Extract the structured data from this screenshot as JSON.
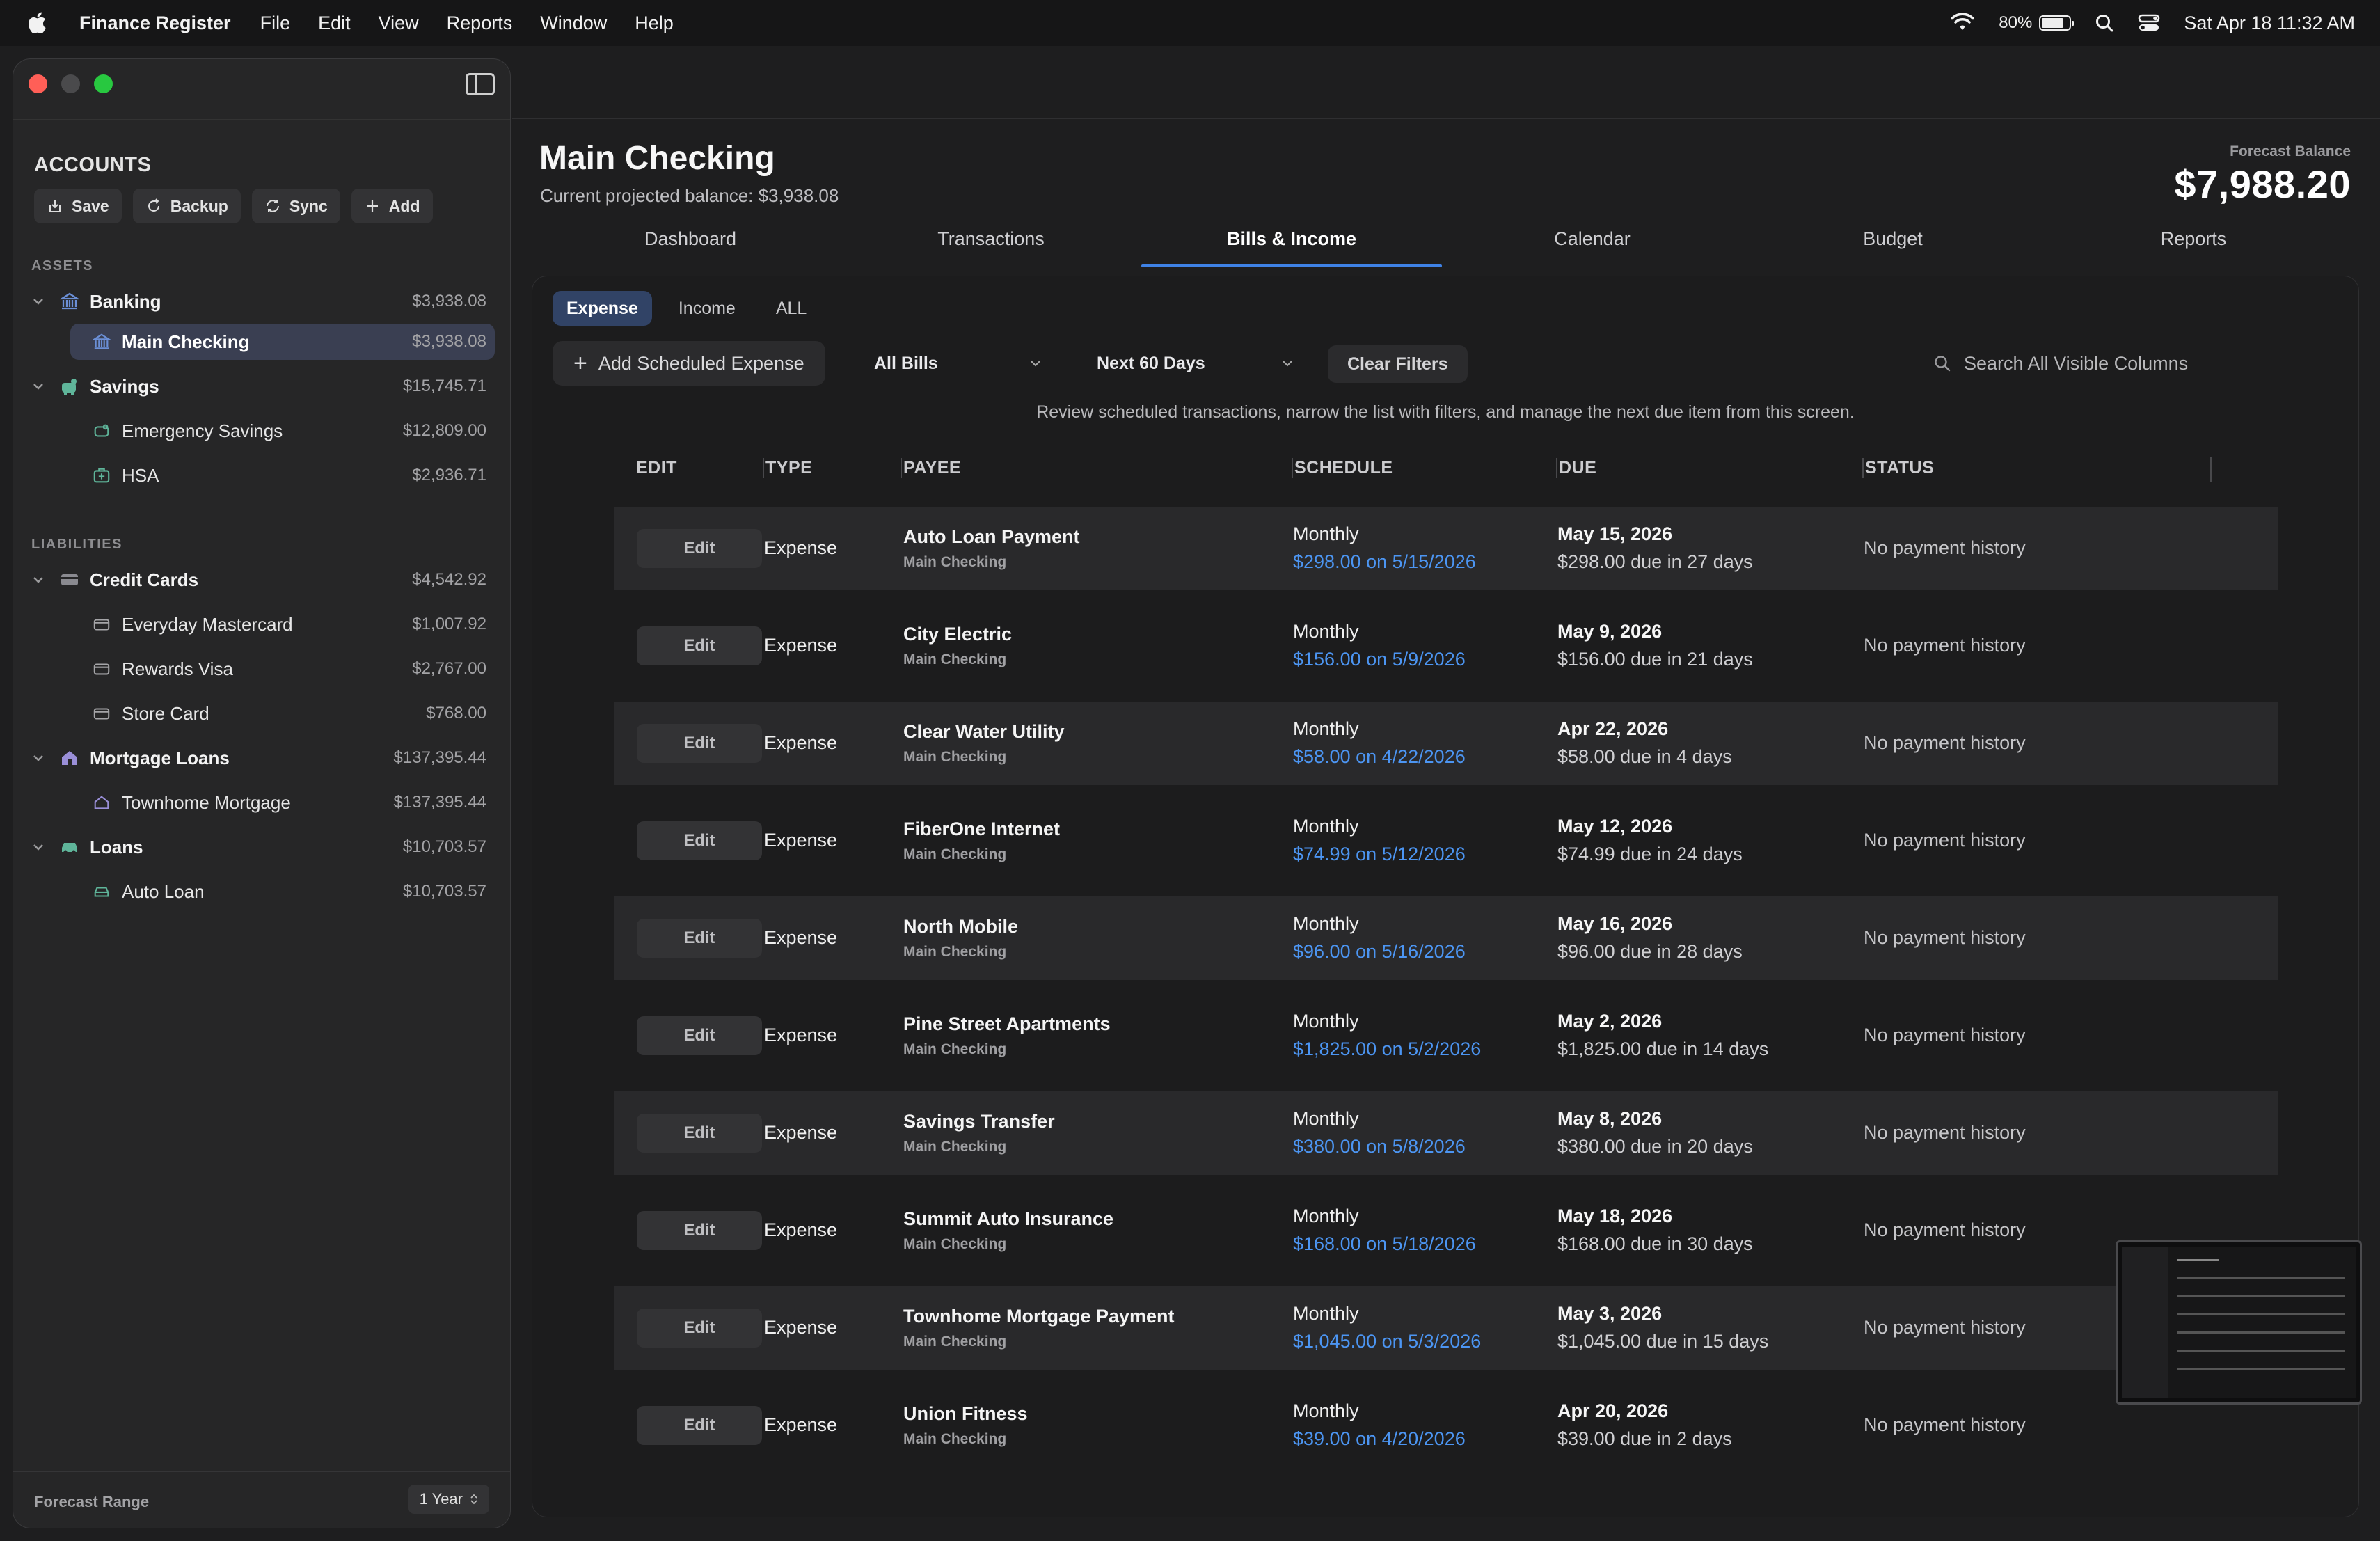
{
  "menubar": {
    "app_name": "Finance Register",
    "menus": [
      "File",
      "Edit",
      "View",
      "Reports",
      "Window",
      "Help"
    ],
    "battery": "80%",
    "datetime": "Sat Apr 18  11:32 AM"
  },
  "sidebar": {
    "title": "ACCOUNTS",
    "actions": {
      "save": "Save",
      "backup": "Backup",
      "sync": "Sync",
      "add": "Add"
    },
    "assets_label": "ASSETS",
    "liabilities_label": "LIABILITIES",
    "banking": {
      "label": "Banking",
      "amount": "$3,938.08"
    },
    "main_checking": {
      "label": "Main Checking",
      "amount": "$3,938.08"
    },
    "savings": {
      "label": "Savings",
      "amount": "$15,745.71"
    },
    "emergency_savings": {
      "label": "Emergency Savings",
      "amount": "$12,809.00"
    },
    "hsa": {
      "label": "HSA",
      "amount": "$2,936.71"
    },
    "credit_cards": {
      "label": "Credit Cards",
      "amount": "$4,542.92"
    },
    "everyday_mastercard": {
      "label": "Everyday Mastercard",
      "amount": "$1,007.92"
    },
    "rewards_visa": {
      "label": "Rewards Visa",
      "amount": "$2,767.00"
    },
    "store_card": {
      "label": "Store Card",
      "amount": "$768.00"
    },
    "mortgage_loans": {
      "label": "Mortgage Loans",
      "amount": "$137,395.44"
    },
    "townhome_mortgage": {
      "label": "Townhome Mortgage",
      "amount": "$137,395.44"
    },
    "loans": {
      "label": "Loans",
      "amount": "$10,703.57"
    },
    "auto_loan": {
      "label": "Auto Loan",
      "amount": "$10,703.57"
    },
    "forecast_range_label": "Forecast Range",
    "forecast_range_value": "1 Year"
  },
  "header": {
    "title": "Main Checking",
    "subtitle": "Current projected balance: $3,938.08",
    "forecast_label": "Forecast Balance",
    "forecast_value": "$7,988.20"
  },
  "tabs": [
    "Dashboard",
    "Transactions",
    "Bills & Income",
    "Calendar",
    "Budget",
    "Reports"
  ],
  "filters": {
    "segments": [
      "Expense",
      "Income",
      "ALL"
    ],
    "add_button": "Add Scheduled Expense",
    "bills_select": "All Bills",
    "range_select": "Next 60 Days",
    "clear_button": "Clear Filters",
    "search_placeholder": "Search All Visible Columns"
  },
  "helper_text": "Review scheduled transactions, narrow the list with filters, and manage the next due item from this screen.",
  "table": {
    "columns": [
      "EDIT",
      "TYPE",
      "PAYEE",
      "SCHEDULE",
      "DUE",
      "STATUS"
    ],
    "edit_label": "Edit",
    "rows": [
      {
        "type": "Expense",
        "payee": "Auto Loan Payment",
        "account": "Main Checking",
        "freq": "Monthly",
        "amount": "$298.00 on 5/15/2026",
        "due": "May 15, 2026",
        "due_detail": "$298.00 due in 27 days",
        "status": "No payment history"
      },
      {
        "type": "Expense",
        "payee": "City Electric",
        "account": "Main Checking",
        "freq": "Monthly",
        "amount": "$156.00 on 5/9/2026",
        "due": "May 9, 2026",
        "due_detail": "$156.00 due in 21 days",
        "status": "No payment history"
      },
      {
        "type": "Expense",
        "payee": "Clear Water Utility",
        "account": "Main Checking",
        "freq": "Monthly",
        "amount": "$58.00 on 4/22/2026",
        "due": "Apr 22, 2026",
        "due_detail": "$58.00 due in 4 days",
        "status": "No payment history"
      },
      {
        "type": "Expense",
        "payee": "FiberOne Internet",
        "account": "Main Checking",
        "freq": "Monthly",
        "amount": "$74.99 on 5/12/2026",
        "due": "May 12, 2026",
        "due_detail": "$74.99 due in 24 days",
        "status": "No payment history"
      },
      {
        "type": "Expense",
        "payee": "North Mobile",
        "account": "Main Checking",
        "freq": "Monthly",
        "amount": "$96.00 on 5/16/2026",
        "due": "May 16, 2026",
        "due_detail": "$96.00 due in 28 days",
        "status": "No payment history"
      },
      {
        "type": "Expense",
        "payee": "Pine Street Apartments",
        "account": "Main Checking",
        "freq": "Monthly",
        "amount": "$1,825.00 on 5/2/2026",
        "due": "May 2, 2026",
        "due_detail": "$1,825.00 due in 14 days",
        "status": "No payment history"
      },
      {
        "type": "Expense",
        "payee": "Savings Transfer",
        "account": "Main Checking",
        "freq": "Monthly",
        "amount": "$380.00 on 5/8/2026",
        "due": "May 8, 2026",
        "due_detail": "$380.00 due in 20 days",
        "status": "No payment history"
      },
      {
        "type": "Expense",
        "payee": "Summit Auto Insurance",
        "account": "Main Checking",
        "freq": "Monthly",
        "amount": "$168.00 on 5/18/2026",
        "due": "May 18, 2026",
        "due_detail": "$168.00 due in 30 days",
        "status": "No payment history"
      },
      {
        "type": "Expense",
        "payee": "Townhome Mortgage Payment",
        "account": "Main Checking",
        "freq": "Monthly",
        "amount": "$1,045.00 on 5/3/2026",
        "due": "May 3, 2026",
        "due_detail": "$1,045.00 due in 15 days",
        "status": "No payment history"
      },
      {
        "type": "Expense",
        "payee": "Union Fitness",
        "account": "Main Checking",
        "freq": "Monthly",
        "amount": "$39.00 on 4/20/2026",
        "due": "Apr 20, 2026",
        "due_detail": "$39.00 due in 2 days",
        "status": "No payment history"
      }
    ]
  },
  "colors": {
    "accent": "#3f82e6",
    "link": "#4c95f2",
    "selected_row": "#3a3f52",
    "close": "#ff5f57",
    "zoom": "#28c840"
  }
}
